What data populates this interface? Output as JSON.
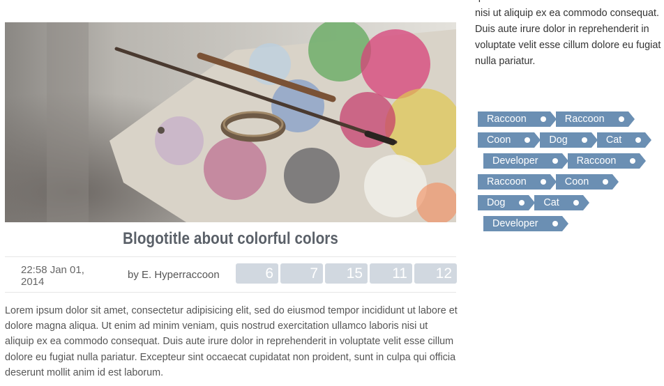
{
  "post": {
    "image_alt": "Painter's palette with brushes and paint",
    "title": "Blogotitle about colorful colors",
    "date": "22:58 Jan 01, 2014",
    "author": "by E. Hyperraccoon",
    "counters": [
      "6",
      "7",
      "15",
      "11",
      "12"
    ],
    "body": "Lorem ipsum dolor sit amet, consectetur adipisicing elit, sed do eiusmod tempor incididunt ut labore et dolore magna aliqua. Ut enim ad minim veniam, quis nostrud exercitation ullamco laboris nisi ut aliquip ex ea commodo consequat. Duis aute irure dolor in reprehenderit in voluptate velit esse cillum dolore eu fugiat nulla pariatur. Excepteur sint occaecat cupidatat non proident, sunt in culpa qui officia deserunt mollit anim id est laborum."
  },
  "sidebar": {
    "text": "quis nostrud exercitation ullamco laboris nisi ut aliquip ex ea commodo consequat. Duis aute irure dolor in reprehenderit in voluptate velit esse cillum dolore eu fugiat nulla pariatur.",
    "tag_rows": [
      [
        "Raccoon",
        "Raccoon"
      ],
      [
        "Coon",
        "Dog",
        "Cat"
      ],
      [
        "Developer",
        "Raccoon"
      ],
      [
        "Raccoon",
        "Coon"
      ],
      [
        "Dog",
        "Cat"
      ],
      [
        "Developer"
      ]
    ]
  },
  "colors": {
    "tag_bg": "#6b8fb3",
    "counter_bg": "#d1d8e0",
    "title_color": "#5a6068"
  }
}
